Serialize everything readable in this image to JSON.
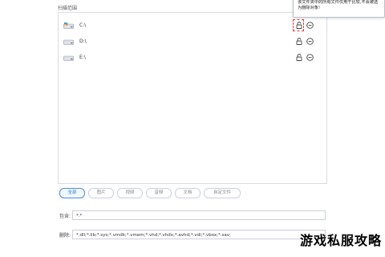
{
  "scan_scope": {
    "title": "扫描范围",
    "drives": [
      {
        "label": "C:\\",
        "icon": "windows-drive-icon"
      },
      {
        "label": "D:\\",
        "icon": "drive-icon"
      },
      {
        "label": "E:\\",
        "icon": "drive-icon"
      }
    ],
    "tooltip": "该文件夹中的所有文件仅用于比较,不会被选为删除对象!"
  },
  "filters": [
    "全部",
    "图片",
    "视频",
    "音频",
    "文档",
    "自定文件"
  ],
  "filters_active_index": 0,
  "include": {
    "label": "包含:",
    "value": "*.*"
  },
  "exclude": {
    "label": "删除:",
    "value": "*.dll;*.lib;*.sys;*.vmdk;*.vmem;*.vhd;*.vhdx;*.avhd;*.vdi;*.vbox;*.sav;"
  },
  "watermark": "游戏私服攻略",
  "colors": {
    "accent": "#3679d4",
    "highlight": "#e23b3b"
  }
}
